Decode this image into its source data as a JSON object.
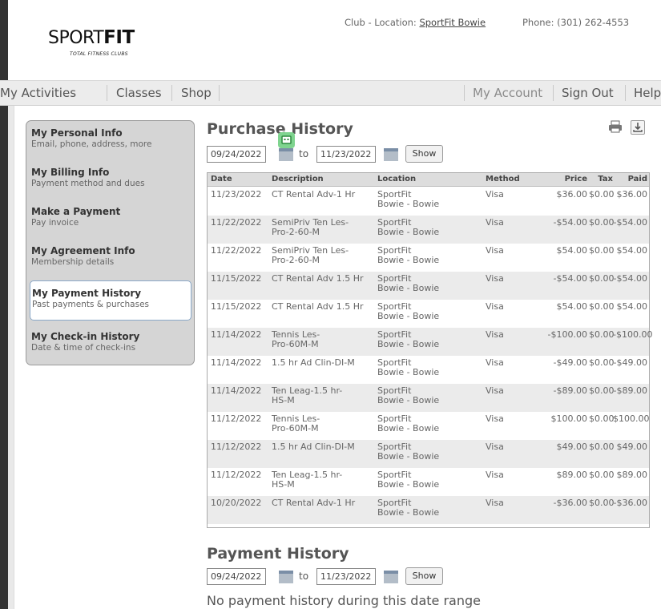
{
  "header": {
    "logo_text_light": "SPORT",
    "logo_text_bold": "FIT",
    "logo_tagline": "TOTAL FITNESS CLUBS",
    "club_label": "Club - Location:",
    "club_link": "SportFit Bowie",
    "phone": "Phone: (301) 262-4553"
  },
  "nav": {
    "items": [
      "My Activities",
      "Classes",
      "Shop"
    ],
    "right_items": [
      "My Account",
      "Sign Out",
      "Help"
    ]
  },
  "sidebar": {
    "items": [
      {
        "title": "My Personal Info",
        "subtitle": "Email, phone, address, more"
      },
      {
        "title": "My Billing Info",
        "subtitle": "Payment method and dues"
      },
      {
        "title": "Make a Payment",
        "subtitle": "Pay invoice"
      },
      {
        "title": "My Agreement Info",
        "subtitle": "Membership details"
      },
      {
        "title": "My Payment History",
        "subtitle": "Past payments & purchases"
      },
      {
        "title": "My Check-in History",
        "subtitle": "Date & time of check-ins"
      }
    ]
  },
  "purchase": {
    "title": "Purchase History",
    "from": "09/24/2022",
    "to_label": "to",
    "to": "11/23/2022",
    "show": "Show",
    "columns": [
      "Date",
      "Description",
      "Location",
      "Method",
      "Price",
      "Tax",
      "Paid"
    ],
    "rows": [
      [
        "11/23/2022",
        "CT Rental Adv-1 Hr",
        "SportFit\nBowie - Bowie",
        "Visa",
        "$36.00",
        "$0.00",
        "$36.00"
      ],
      [
        "11/22/2022",
        "SemiPriv Ten Les-\nPro-2-60-M",
        "SportFit\nBowie - Bowie",
        "Visa",
        "-$54.00",
        "$0.00",
        "-$54.00"
      ],
      [
        "11/22/2022",
        "SemiPriv Ten Les-\nPro-2-60-M",
        "SportFit\nBowie - Bowie",
        "Visa",
        "$54.00",
        "$0.00",
        "$54.00"
      ],
      [
        "11/15/2022",
        "CT Rental Adv 1.5 Hr",
        "SportFit\nBowie - Bowie",
        "Visa",
        "-$54.00",
        "$0.00",
        "-$54.00"
      ],
      [
        "11/15/2022",
        "CT Rental Adv 1.5 Hr",
        "SportFit\nBowie - Bowie",
        "Visa",
        "$54.00",
        "$0.00",
        "$54.00"
      ],
      [
        "11/14/2022",
        "Tennis Les-\nPro-60M-M",
        "SportFit\nBowie - Bowie",
        "Visa",
        "-$100.00",
        "$0.00",
        "-$100.00"
      ],
      [
        "11/14/2022",
        "1.5 hr Ad Clin-DI-M",
        "SportFit\nBowie - Bowie",
        "Visa",
        "-$49.00",
        "$0.00",
        "-$49.00"
      ],
      [
        "11/14/2022",
        "Ten Leag-1.5 hr-\nHS-M",
        "SportFit\nBowie - Bowie",
        "Visa",
        "-$89.00",
        "$0.00",
        "-$89.00"
      ],
      [
        "11/12/2022",
        "Tennis Les-\nPro-60M-M",
        "SportFit\nBowie - Bowie",
        "Visa",
        "$100.00",
        "$0.00",
        "$100.00"
      ],
      [
        "11/12/2022",
        "1.5 hr Ad Clin-DI-M",
        "SportFit\nBowie - Bowie",
        "Visa",
        "$49.00",
        "$0.00",
        "$49.00"
      ],
      [
        "11/12/2022",
        "Ten Leag-1.5 hr-\nHS-M",
        "SportFit\nBowie - Bowie",
        "Visa",
        "$89.00",
        "$0.00",
        "$89.00"
      ],
      [
        "10/20/2022",
        "CT Rental Adv-1 Hr",
        "SportFit\nBowie - Bowie",
        "Visa",
        "-$36.00",
        "$0.00",
        "-$36.00"
      ]
    ]
  },
  "payment": {
    "title": "Payment History",
    "from": "09/24/2022",
    "to_label": "to",
    "to": "11/23/2022",
    "show": "Show",
    "empty": "No payment history during this date range"
  },
  "icons": {
    "print": "printer-icon",
    "download": "download-icon",
    "calendar": "calendar-icon",
    "extension": "extension-icon"
  }
}
